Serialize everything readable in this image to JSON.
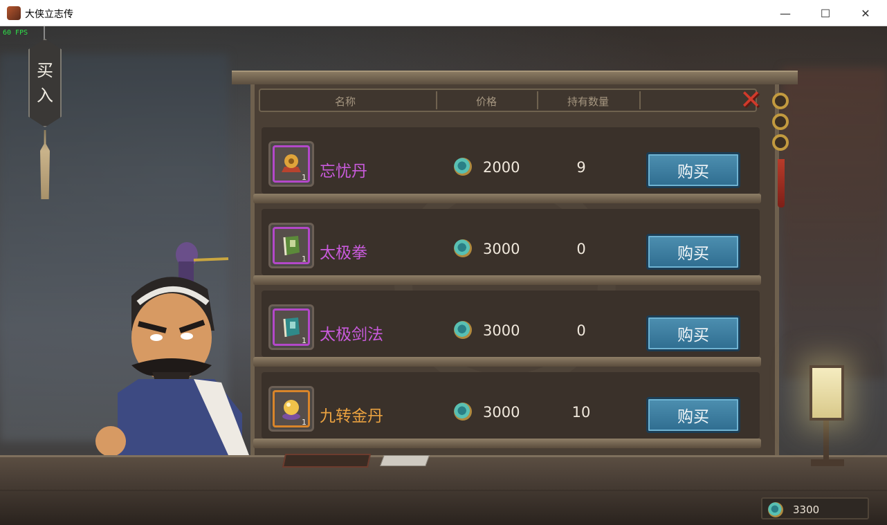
{
  "window": {
    "title": "大侠立志传",
    "minimize_icon": "—",
    "maximize_icon": "☐",
    "close_icon": "✕"
  },
  "hud": {
    "fps": "60 FPS",
    "buy_sign": [
      "买",
      "入"
    ]
  },
  "shop": {
    "columns": {
      "name": "名称",
      "price": "价格",
      "owned": "持有数量"
    },
    "close_icon": "✕",
    "items": [
      {
        "name": "忘忧丹",
        "price": "2000",
        "owned": "9",
        "qty": "1",
        "rarity": "purple",
        "icon": "pill-on-stand-icon",
        "buy_label": "购买"
      },
      {
        "name": "太极拳",
        "price": "3000",
        "owned": "0",
        "qty": "1",
        "rarity": "purple",
        "icon": "green-book-icon",
        "buy_label": "购买"
      },
      {
        "name": "太极剑法",
        "price": "3000",
        "owned": "0",
        "qty": "1",
        "rarity": "purple",
        "icon": "teal-book-icon",
        "buy_label": "购买"
      },
      {
        "name": "九转金丹",
        "price": "3000",
        "owned": "10",
        "qty": "1",
        "rarity": "gold",
        "icon": "golden-pearl-icon",
        "buy_label": "购买"
      }
    ]
  },
  "wallet": {
    "money": "3300"
  },
  "colors": {
    "purple": "#c95bdc",
    "gold": "#eba240",
    "button": "#3c7ea3"
  }
}
